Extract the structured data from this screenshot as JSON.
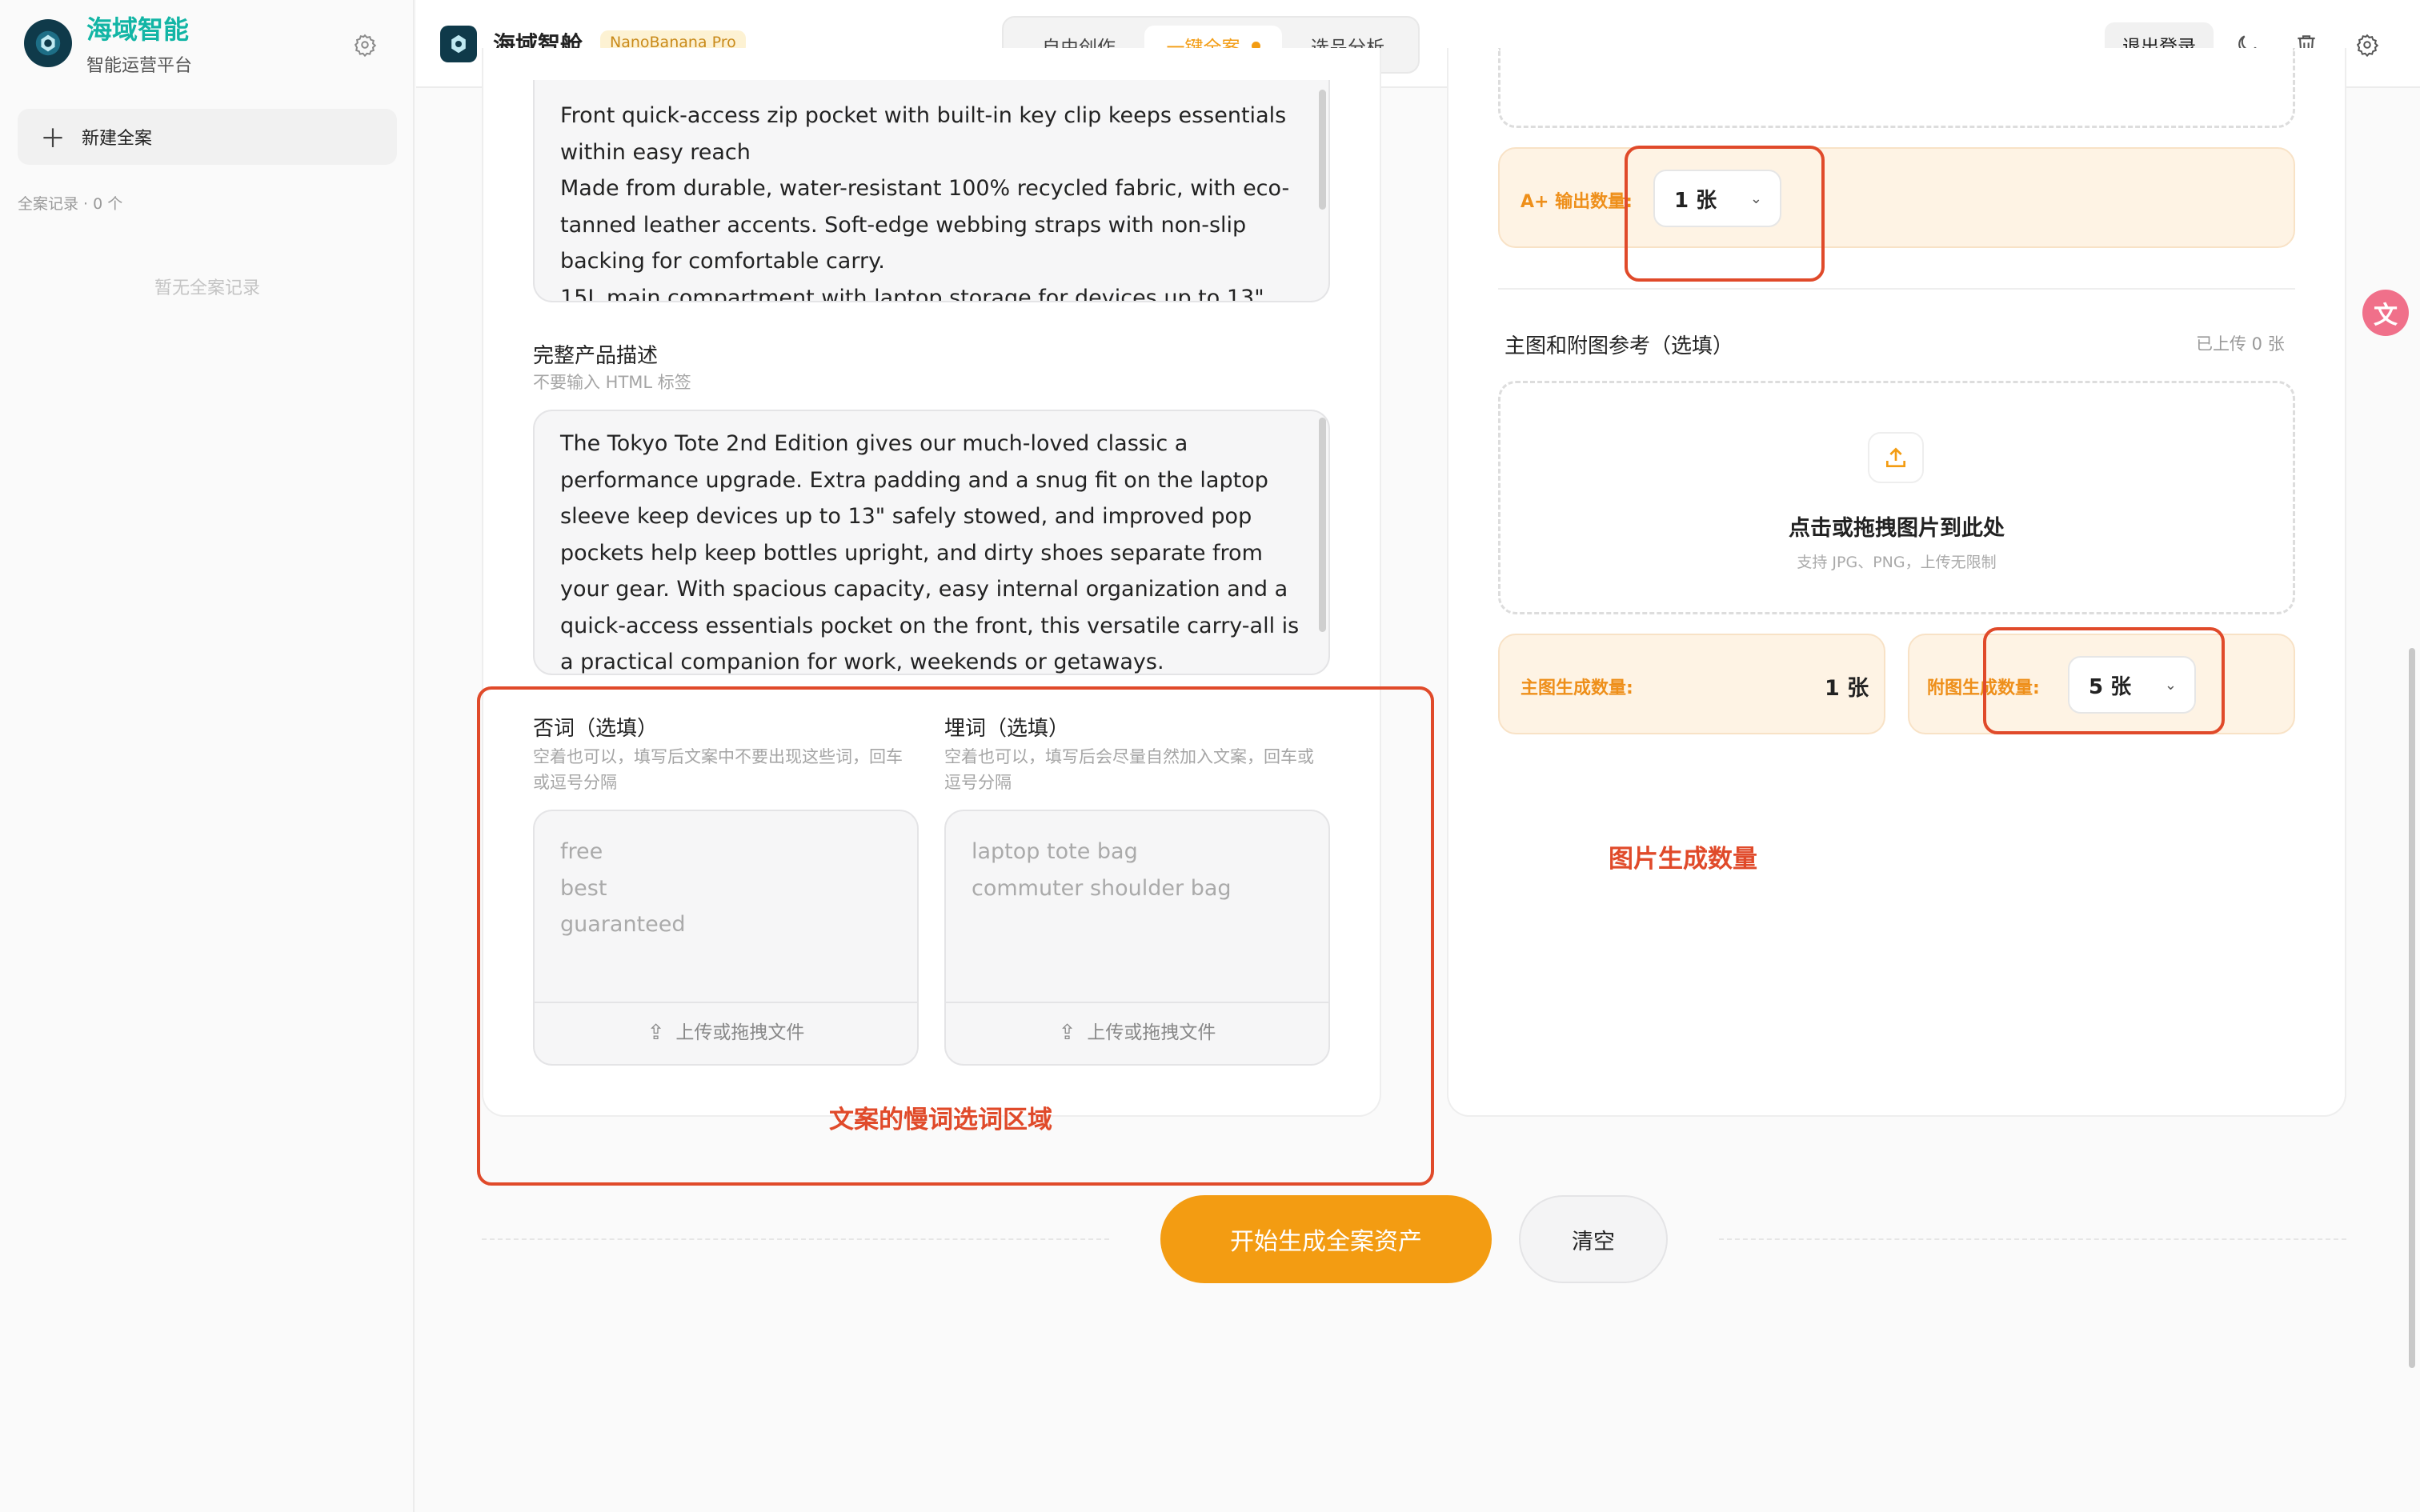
{
  "sidebar": {
    "brand_title": "海域智能",
    "brand_subtitle": "智能运营平台",
    "new_case_label": "新建全案",
    "records_label": "全案记录 · 0 个",
    "empty_label": "暂无全案记录"
  },
  "header": {
    "app_name": "海域智舱",
    "model_tag": "NanoBanana Pro",
    "tabs": [
      {
        "label": "自由创作"
      },
      {
        "label": "一键全案"
      },
      {
        "label": "选品分析"
      }
    ],
    "active_tab": "一键全案",
    "logout_label": "退出登录",
    "icons": [
      "moon-icon",
      "trash-icon",
      "gear-icon"
    ]
  },
  "left_panel": {
    "features_text": "Front quick-access zip pocket with built-in key clip keeps essentials within easy reach\nMade from durable, water-resistant 100% recycled fabric, with eco-tanned leather accents. Soft-edge webbing straps with non-slip backing for comfortable carry.\n15L main compartment with laptop storage for devices up to 13\"",
    "full_desc_label": "完整产品描述",
    "full_desc_hint": "不要输入 HTML 标签",
    "full_desc_text": "The Tokyo Tote 2nd Edition gives our much-loved classic a performance upgrade. Extra padding and a snug fit on the laptop sleeve keep devices up to 13\" safely stowed, and improved pop pockets help keep bottles upright, and dirty shoes separate from your gear. With spacious capacity, easy internal organization and a quick-access essentials pocket on the front, this versatile carry-all is a practical companion for work, weekends or getaways.",
    "negative": {
      "label": "否词（选填）",
      "hint": "空着也可以，填写后文案中不要出现这些词，回车或逗号分隔",
      "placeholder": "free\nbest\nguaranteed",
      "upload_label": "上传或拖拽文件"
    },
    "embed": {
      "label": "埋词（选填）",
      "hint": "空着也可以，填写后会尽量自然加入文案，回车或逗号分隔",
      "placeholder": "laptop tote bag\ncommuter shoulder bag",
      "upload_label": "上传或拖拽文件"
    },
    "annotation": "文案的慢词选词区域"
  },
  "right_panel": {
    "aplus_label": "A+ 输出数量:",
    "aplus_value": "1 张",
    "ref_label": "主图和附图参考（选填）",
    "ref_count": "已上传 0 张",
    "drop_title": "点击或拖拽图片到此处",
    "drop_hint": "支持 JPG、PNG，上传无限制",
    "main_count_label": "主图生成数量:",
    "main_count_value": "1 张",
    "sub_count_label": "附图生成数量:",
    "sub_count_value": "5 张",
    "annotation": "图片生成数量"
  },
  "actions": {
    "start_label": "开始生成全案资产",
    "clear_label": "清空"
  },
  "colors": {
    "accent": "#f39c12",
    "brand_teal": "#12b5a5",
    "annotation_red": "#e04a2a"
  }
}
